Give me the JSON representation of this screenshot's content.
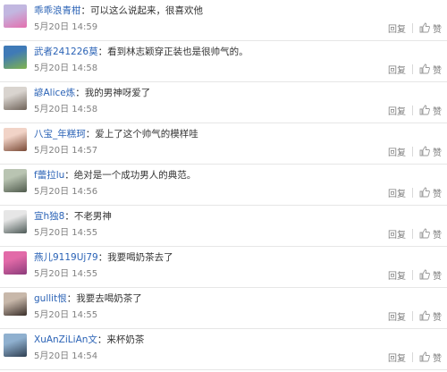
{
  "comments": [
    {
      "user": "乖乖浪青柑",
      "text": "：可以这么说起来，很喜欢他",
      "time": "5月20日 14:59",
      "reply": "回复",
      "like": "赞",
      "avatar": [
        "#c2b7e0",
        "#e46fae"
      ]
    },
    {
      "user": "武者241226莫",
      "text": "：看到林志颖穿正装也是很帅气的。",
      "time": "5月20日 14:58",
      "reply": "回复",
      "like": "赞",
      "avatar": [
        "#3f7ab7",
        "#7fb34d"
      ]
    },
    {
      "user": "諺Alice炼",
      "text": "：我的男神呀爱了",
      "time": "5月20日 14:58",
      "reply": "回复",
      "like": "赞",
      "avatar": [
        "#d9d4cf",
        "#6e6258"
      ]
    },
    {
      "user": "八宝_年糕珂",
      "text": "：爱上了这个帅气的模样哇",
      "time": "5月20日 14:57",
      "reply": "回复",
      "like": "赞",
      "avatar": [
        "#f1d3c7",
        "#7a4a36"
      ]
    },
    {
      "user": "f蕾拉lu",
      "text": "：绝对是一个成功男人的典范。",
      "time": "5月20日 14:56",
      "reply": "回复",
      "like": "赞",
      "avatar": [
        "#b9c4b2",
        "#4f5a4c"
      ]
    },
    {
      "user": "宣h独8",
      "text": "：不老男神",
      "time": "5月20日 14:55",
      "reply": "回复",
      "like": "赞",
      "avatar": [
        "#e6e6e6",
        "#4d5a57"
      ]
    },
    {
      "user": "燕儿9119Uj79",
      "text": "：我要喝奶茶去了",
      "time": "5月20日 14:55",
      "reply": "回复",
      "like": "赞",
      "avatar": [
        "#e26aa8",
        "#8c3b7a"
      ]
    },
    {
      "user": "gullit恨",
      "text": "：我要去喝奶茶了",
      "time": "5月20日 14:55",
      "reply": "回复",
      "like": "赞",
      "avatar": [
        "#c8b8aa",
        "#3a2f2a"
      ]
    },
    {
      "user": "XuAnZiLiAn文",
      "text": "：来杯奶茶",
      "time": "5月20日 14:54",
      "reply": "回复",
      "like": "赞",
      "avatar": [
        "#8fb0cf",
        "#2f3f52"
      ]
    }
  ]
}
